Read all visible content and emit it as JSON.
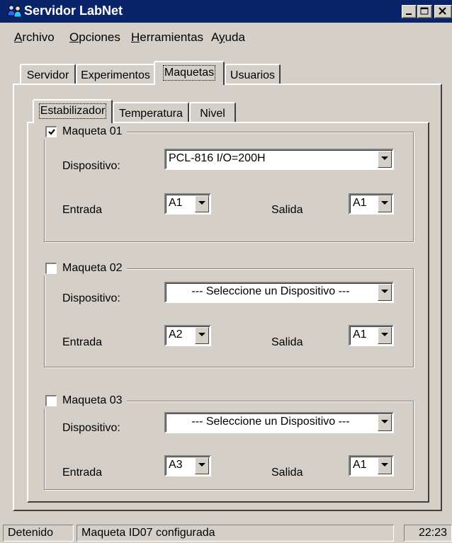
{
  "window": {
    "title": "Servidor LabNet"
  },
  "menu": [
    {
      "label": "Archivo",
      "access": "A",
      "rest": "rchivo"
    },
    {
      "label": "Opciones",
      "access": "O",
      "rest": "pciones"
    },
    {
      "label": "Herramientas",
      "access": "H",
      "rest": "erramientas"
    },
    {
      "label": "Ayuda",
      "pre": "A",
      "access": "y",
      "rest": "uda"
    }
  ],
  "main_tabs": [
    "Servidor",
    "Experimentos",
    "Maquetas",
    "Usuarios"
  ],
  "main_tabs_active": "Maquetas",
  "sub_tabs": [
    "Estabilizador",
    "Temperatura",
    "Nivel"
  ],
  "sub_tabs_active": "Estabilizador",
  "groups": [
    {
      "title": "Maqueta 01",
      "checked": true,
      "device_label": "Dispositivo:",
      "device_value": "PCL-816 I/O=200H",
      "input_label": "Entrada",
      "input_value": "A1",
      "output_label": "Salida",
      "output_value": "A1"
    },
    {
      "title": "Maqueta 02",
      "checked": false,
      "device_label": "Dispositivo:",
      "device_value": "--- Seleccione un Dispositivo ---",
      "input_label": "Entrada",
      "input_value": "A2",
      "output_label": "Salida",
      "output_value": "A1"
    },
    {
      "title": "Maqueta 03",
      "checked": false,
      "device_label": "Dispositivo:",
      "device_value": "--- Seleccione un Dispositivo ---",
      "input_label": "Entrada",
      "input_value": "A3",
      "output_label": "Salida",
      "output_value": "A1"
    }
  ],
  "status": {
    "state": "Detenido",
    "message": "Maqueta ID07 configurada",
    "time": "22:23"
  },
  "colors": {
    "titlebar": "#0a246a",
    "face": "#d4d0c8"
  },
  "icons": {
    "app": "users-icon",
    "minimize": "minimize-icon",
    "maximize": "maximize-icon",
    "close": "close-icon",
    "dropdown": "chevron-down-icon",
    "check": "check-icon"
  }
}
